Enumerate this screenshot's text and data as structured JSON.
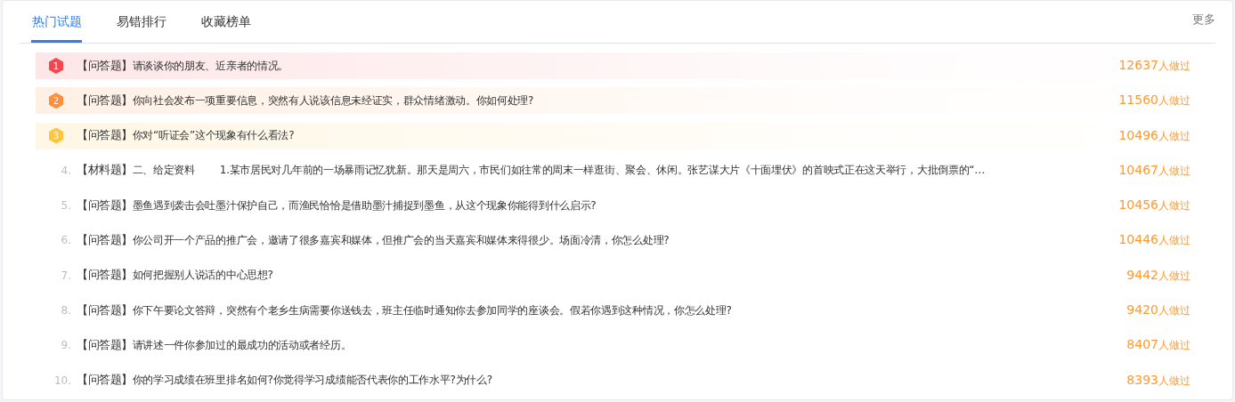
{
  "tabs": [
    {
      "label": "热门试题",
      "selected": true
    },
    {
      "label": "易错排行",
      "selected": false
    },
    {
      "label": "收藏榜单",
      "selected": false
    }
  ],
  "more": "更多",
  "rows": [
    {
      "kind": "badge",
      "rank": "1",
      "color": "#f5454f",
      "tag": "【问答题】",
      "text": "请谈谈你的朋友、近亲者的情况。",
      "count": "12637",
      "suffix": "人做过"
    },
    {
      "kind": "badge",
      "rank": "2",
      "color": "#ff8f3a",
      "tag": "【问答题】",
      "text": "你向社会发布一项重要信息，突然有人说该信息未经证实，群众情绪激动。你如何处理?",
      "count": "11560",
      "suffix": "人做过"
    },
    {
      "kind": "badge",
      "rank": "3",
      "color": "#ffc53d",
      "tag": "【问答题】",
      "text": "你对“听证会”这个现象有什么看法?",
      "count": "10496",
      "suffix": "人做过"
    },
    {
      "kind": "number",
      "rank": "4.",
      "tag": "【材料题】",
      "text": "二、给定资料        1.某市居民对几年前的一场暴雨记忆犹新。那天是周六，市民们如往常的周末一样逛街、聚会、休闲。张艺谋大片《十面埋伏》的首映式正在这天举行，大批倒票的“…",
      "count": "10467",
      "suffix": "人做过"
    },
    {
      "kind": "number",
      "rank": "5.",
      "tag": "【问答题】",
      "text": "墨鱼遇到袭击会吐墨汁保护自己，而渔民恰恰是借助墨汁捕捉到墨鱼，从这个现象你能得到什么启示?",
      "count": "10456",
      "suffix": "人做过"
    },
    {
      "kind": "number",
      "rank": "6.",
      "tag": "【问答题】",
      "text": "你公司开一个产品的推广会，邀请了很多嘉宾和媒体，但推广会的当天嘉宾和媒体来得很少。场面冷清，你怎么处理?",
      "count": "10446",
      "suffix": "人做过"
    },
    {
      "kind": "number",
      "rank": "7.",
      "tag": "【问答题】",
      "text": "如何把握别人说话的中心思想?",
      "count": "9442",
      "suffix": "人做过"
    },
    {
      "kind": "number",
      "rank": "8.",
      "tag": "【问答题】",
      "text": "你下午要论文答辩，突然有个老乡生病需要你送钱去，班主任临时通知你去参加同学的座谈会。假若你遇到这种情况，你怎么处理?",
      "count": "9420",
      "suffix": "人做过"
    },
    {
      "kind": "number",
      "rank": "9.",
      "tag": "【问答题】",
      "text": "请讲述一件你参加过的最成功的活动或者经历。",
      "count": "8407",
      "suffix": "人做过"
    },
    {
      "kind": "number",
      "rank": "10.",
      "tag": "【问答题】",
      "text": "你的学习成绩在班里排名如何?你觉得学习成绩能否代表你的工作水平?为什么?",
      "count": "8393",
      "suffix": "人做过"
    }
  ]
}
